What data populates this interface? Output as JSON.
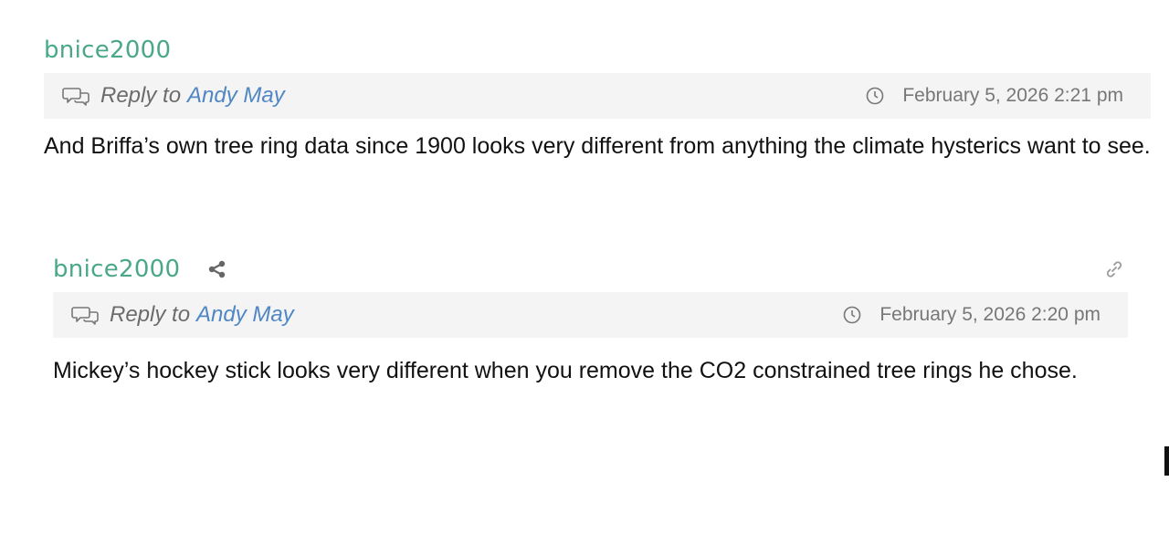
{
  "comments": [
    {
      "author": "bnice2000",
      "reply_prefix": "Reply to",
      "reply_target": "Andy May",
      "timestamp": "February 5, 2026 2:21 pm",
      "text": "And Briffa’s own tree ring data since 1900 looks very different from anything the climate hysterics want to see."
    },
    {
      "author": "bnice2000",
      "reply_prefix": "Reply to",
      "reply_target": "Andy May",
      "timestamp": "February 5, 2026 2:20 pm",
      "text": "Mickey’s hockey stick looks very different when you remove the CO2 constrained tree rings he chose."
    }
  ],
  "icons": {
    "reply": "speech-bubbles-icon",
    "clock": "clock-icon",
    "share": "share-icon",
    "link": "link-icon"
  },
  "colors": {
    "author": "#4aa889",
    "reply_target": "#4f86c4",
    "reply_bar_bg": "#f4f4f4",
    "meta_text": "#777777"
  }
}
